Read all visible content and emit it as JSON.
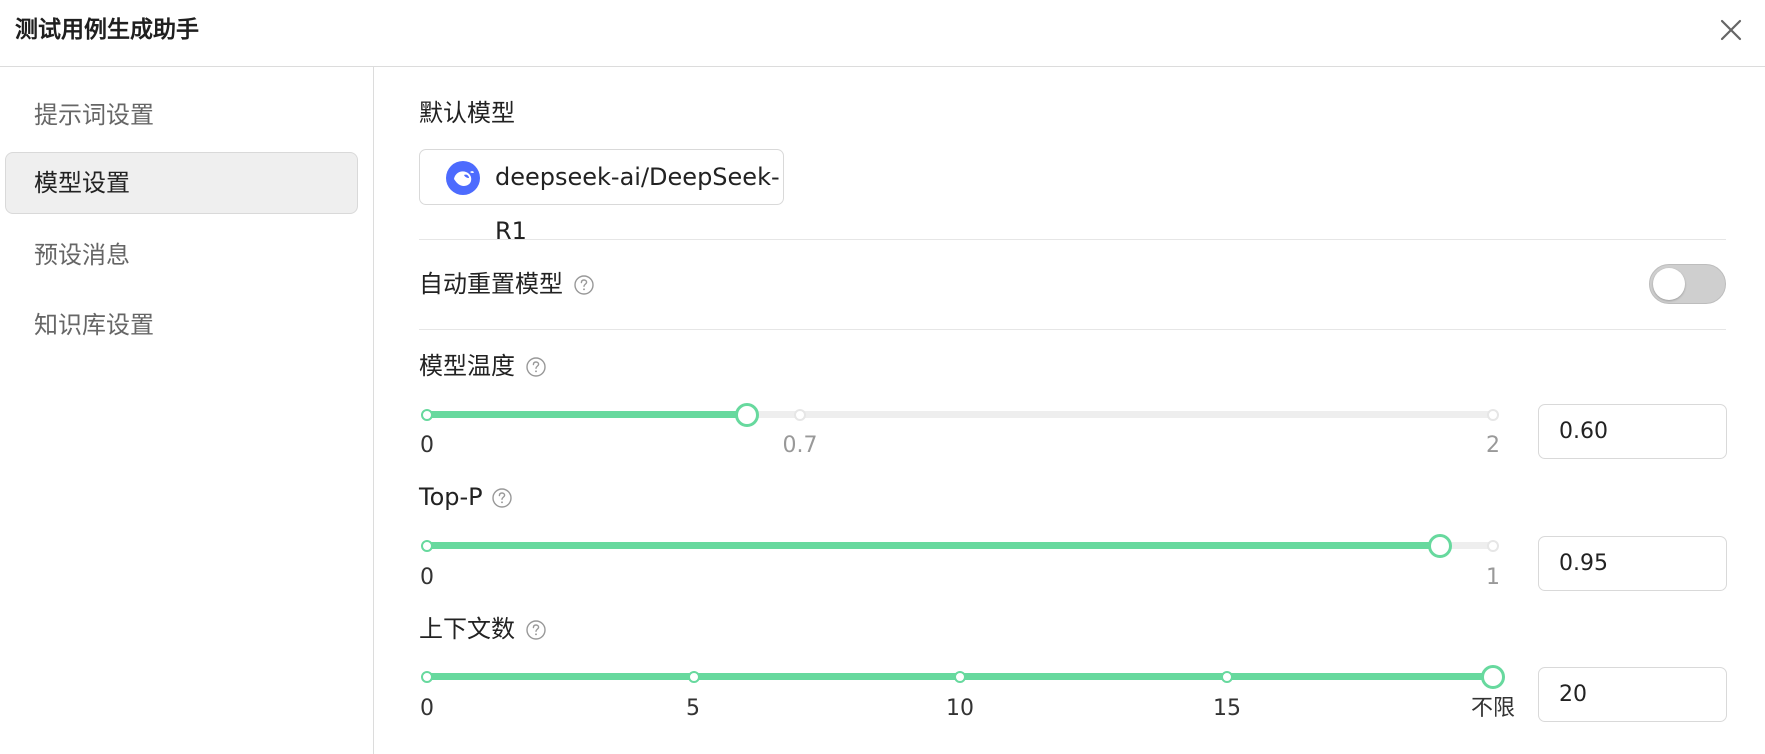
{
  "header": {
    "title": "测试用例生成助手"
  },
  "sidebar": {
    "items": [
      {
        "label": "提示词设置",
        "active": false
      },
      {
        "label": "模型设置",
        "active": true
      },
      {
        "label": "预设消息",
        "active": false
      },
      {
        "label": "知识库设置",
        "active": false
      }
    ]
  },
  "main": {
    "default_model": {
      "label": "默认模型",
      "value": "deepseek-ai/DeepSeek-R1"
    },
    "auto_reset": {
      "label": "自动重置模型",
      "enabled": false
    },
    "temperature": {
      "label": "模型温度",
      "value": "0.60",
      "marks": [
        "0",
        "0.7",
        "2"
      ],
      "min": 0,
      "max": 2,
      "current": 0.6
    },
    "top_p": {
      "label": "Top-P",
      "value": "0.95",
      "marks": [
        "0",
        "1"
      ],
      "min": 0,
      "max": 1,
      "current": 0.95
    },
    "context": {
      "label": "上下文数",
      "value": "20",
      "marks": [
        "0",
        "5",
        "10",
        "15",
        "不限"
      ],
      "current_step": 4,
      "steps": 4
    }
  },
  "colors": {
    "accent": "#67d99e",
    "model_logo": "#4d6bfe"
  }
}
